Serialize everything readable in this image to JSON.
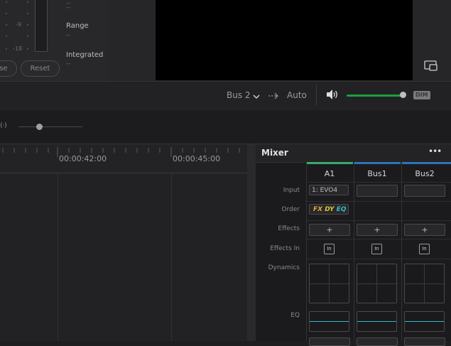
{
  "meter": {
    "scale": [
      "-9",
      "-18"
    ],
    "range_label": "Range",
    "range_value": "--",
    "integrated_label": "Integrated",
    "integrated_value": "--",
    "top_value": "--",
    "pause_label": "se",
    "reset_label": "Reset"
  },
  "transport": {
    "bus_select": "Bus 2",
    "automation_label": "Auto",
    "dim_label": "DIM",
    "volume_fraction": 0.95
  },
  "timeline": {
    "timecodes": [
      "00:00:42:00",
      "00:00:45:00"
    ]
  },
  "mixer": {
    "title": "Mixer",
    "more_icon": "•••",
    "channels": [
      {
        "name": "A1",
        "input": "1: EVO4",
        "color": "#3ea86a"
      },
      {
        "name": "Bus1",
        "input": "",
        "color": "#2f73b8"
      },
      {
        "name": "Bus2",
        "input": "",
        "color": "#2f73b8"
      }
    ],
    "row_labels": {
      "input": "Input",
      "order": "Order",
      "effects": "Effects",
      "effects_in": "Effects In",
      "dynamics": "Dynamics",
      "eq": "EQ"
    },
    "order_tags": [
      "FX",
      "DY",
      "EQ"
    ],
    "plus": "+",
    "in_label": "In"
  }
}
